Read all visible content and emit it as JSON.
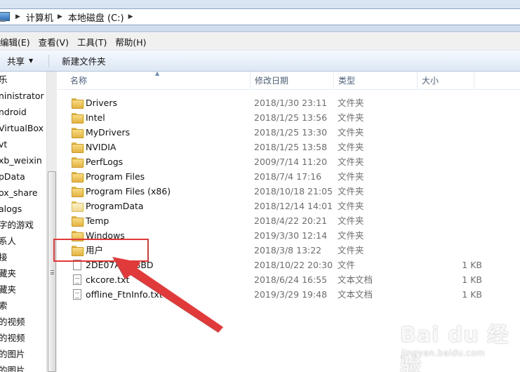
{
  "address": {
    "crumbs": [
      "计算机",
      "本地磁盘 (C:)"
    ]
  },
  "menu": {
    "items": [
      "编辑(E)",
      "查看(V)",
      "工具(T)",
      "帮助(H)"
    ]
  },
  "toolbar": {
    "share_label": "共享",
    "new_folder_label": "新建文件夹"
  },
  "nav": {
    "items": [
      "乐",
      "ninistrator",
      "ndroid",
      "VirtualBox",
      "vt",
      "xb_weixin",
      "pData",
      "ox_share",
      "alogs",
      "字的游戏",
      "系人",
      "接",
      "藏夹",
      "藏夹",
      "索",
      "的视频",
      "的视频",
      "的图片",
      "的图片"
    ]
  },
  "columns": {
    "name": "名称",
    "date": "修改日期",
    "type": "类型",
    "size": "大小"
  },
  "files": [
    {
      "name": "Drivers",
      "date": "2018/1/30 23:11",
      "type": "文件夹",
      "size": "",
      "icon": "folder-icon"
    },
    {
      "name": "Intel",
      "date": "2018/1/25 13:56",
      "type": "文件夹",
      "size": "",
      "icon": "folder-icon"
    },
    {
      "name": "MyDrivers",
      "date": "2018/1/25 13:30",
      "type": "文件夹",
      "size": "",
      "icon": "folder-icon"
    },
    {
      "name": "NVIDIA",
      "date": "2018/1/25 13:58",
      "type": "文件夹",
      "size": "",
      "icon": "folder-icon"
    },
    {
      "name": "PerfLogs",
      "date": "2009/7/14 11:20",
      "type": "文件夹",
      "size": "",
      "icon": "folder-icon"
    },
    {
      "name": "Program Files",
      "date": "2018/7/4 17:16",
      "type": "文件夹",
      "size": "",
      "icon": "folder-icon"
    },
    {
      "name": "Program Files (x86)",
      "date": "2018/10/18 21:05",
      "type": "文件夹",
      "size": "",
      "icon": "folder-icon"
    },
    {
      "name": "ProgramData",
      "date": "2018/12/14 14:01",
      "type": "文件夹",
      "size": "",
      "icon": "folder-icon-light"
    },
    {
      "name": "Temp",
      "date": "2018/4/22 20:21",
      "type": "文件夹",
      "size": "",
      "icon": "folder-icon"
    },
    {
      "name": "Windows",
      "date": "2019/3/30 12:14",
      "type": "文件夹",
      "size": "",
      "icon": "folder-icon"
    },
    {
      "name": "用户",
      "date": "2018/3/8 13:22",
      "type": "文件夹",
      "size": "",
      "icon": "folder-icon"
    },
    {
      "name": "2DE07A8…8BD",
      "date": "2018/10/22 20:30",
      "type": "文件",
      "size": "1 KB",
      "icon": "file-icon"
    },
    {
      "name": "ckcore.txt",
      "date": "2018/6/24 16:55",
      "type": "文本文档",
      "size": "1 KB",
      "icon": "text-file-icon"
    },
    {
      "name": "offline_FtnInfo.txt",
      "date": "2019/3/29 19:48",
      "type": "文本文档",
      "size": "1 KB",
      "icon": "text-file-icon"
    }
  ],
  "watermark": {
    "logo": "Bai du 经验",
    "sub": "jingyan.baidu.com"
  },
  "colors": {
    "annotation": "#e03a3a",
    "header_text": "#4c607a"
  }
}
